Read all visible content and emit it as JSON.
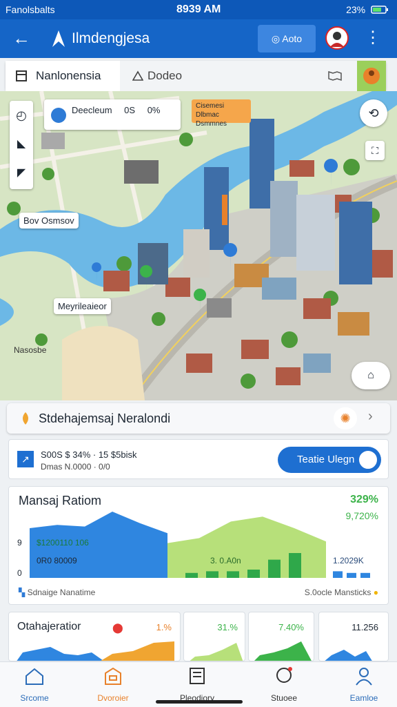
{
  "status_bar": {
    "left": "Fanolsbalts",
    "time": "8939 AM",
    "right": "23%"
  },
  "app_bar": {
    "title": "Ilmdengjesa",
    "chip_label": "Aoto"
  },
  "tabs": [
    {
      "label": "Nanlonensia"
    },
    {
      "label": "Dodeo"
    }
  ],
  "map": {
    "info_card": {
      "label": "Deecleum",
      "value": "0S",
      "extra": "0%"
    },
    "callout": "Cisemesi Dlbmac Dsmmnes",
    "labels": {
      "bay": "Bov Osmsov",
      "marina": "Meyrileaieor",
      "district": "Nasosbe"
    }
  },
  "location_bar": {
    "title": "Stdehajemsaj Neralondi"
  },
  "route": {
    "line1": "S00S $ 34% · 15 $5bisk",
    "line2": "Dmas N.0000 · 0/0",
    "button": "Teatie Ulegn"
  },
  "chart": {
    "title": "Mansaj Ratiom",
    "value_top": "329%",
    "value_second": "9,720%",
    "overlay_1": "$1200110 106",
    "overlay_2": "0R0 80009",
    "overlay_3": "3. 0.A0n",
    "overlay_4": "1.2029K",
    "tick_9": "9",
    "tick_0": "0",
    "footer_left": "Sdnaige Nanatime",
    "footer_right": "S.0ocle Mansticks"
  },
  "chart_data": {
    "type": "area",
    "title": "Mansaj Ratiom",
    "series": [
      {
        "name": "blue",
        "values": [
          60,
          64,
          62,
          80,
          66,
          54
        ]
      },
      {
        "name": "lime",
        "values": [
          42,
          48,
          68,
          74,
          60,
          44
        ]
      },
      {
        "name": "green-bars",
        "values": [
          6,
          8,
          8,
          10,
          22,
          30
        ]
      },
      {
        "name": "blue-bars",
        "values": [
          8,
          6,
          6
        ]
      }
    ]
  },
  "mini_cards": [
    {
      "title": "Otahajeratior",
      "value": "1.%"
    },
    {
      "value": "31.%"
    },
    {
      "value": "7.40%"
    },
    {
      "value": "11.256"
    }
  ],
  "bottom_nav": [
    {
      "label": "Srcome"
    },
    {
      "label": "Dvoroier"
    },
    {
      "label": "Pleodiory"
    },
    {
      "label": "Stuoee"
    },
    {
      "label": "Eamloe"
    }
  ],
  "colors": {
    "primary": "#1565c7",
    "accent": "#e8812b",
    "green": "#3cb34a",
    "lime": "#b7e07a"
  }
}
